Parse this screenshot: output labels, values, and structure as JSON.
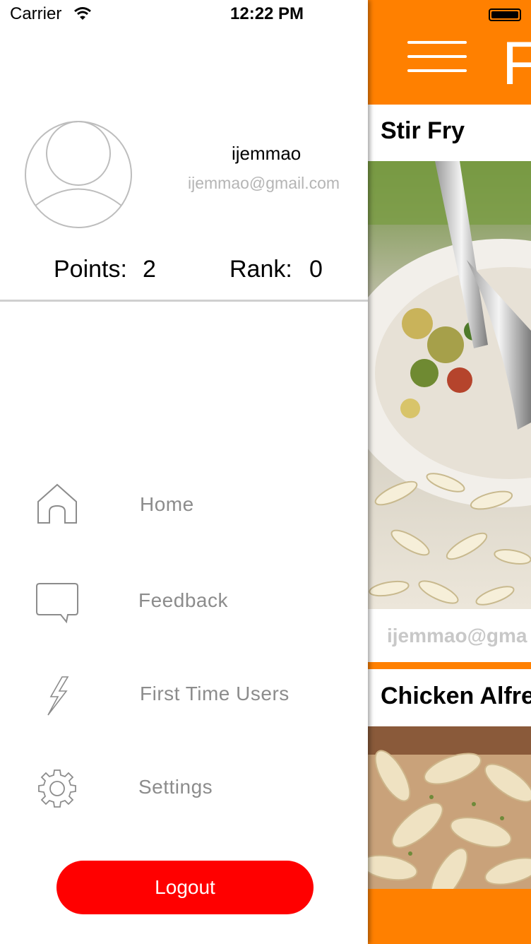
{
  "status_bar": {
    "carrier": "Carrier",
    "time": "12:22 PM"
  },
  "profile": {
    "username": "ijemmao",
    "email": "ijemmao@gmail.com",
    "points_label": "Points:",
    "points_value": "2",
    "rank_label": "Rank:",
    "rank_value": "0"
  },
  "menu": {
    "items": [
      {
        "label": "Home",
        "icon": "home-icon"
      },
      {
        "label": "Feedback",
        "icon": "speech-bubble-icon"
      },
      {
        "label": "First Time Users",
        "icon": "lightning-icon"
      },
      {
        "label": "Settings",
        "icon": "gear-icon"
      }
    ],
    "logout_label": "Logout"
  },
  "feed": {
    "nav_title": "F",
    "cards": [
      {
        "title": "Stir Fry",
        "author": "ijemmao@gma"
      },
      {
        "title": "Chicken Alfre"
      }
    ]
  },
  "colors": {
    "accent": "#ff8000",
    "logout": "#ff0000",
    "muted_text": "#8c8c8c"
  }
}
